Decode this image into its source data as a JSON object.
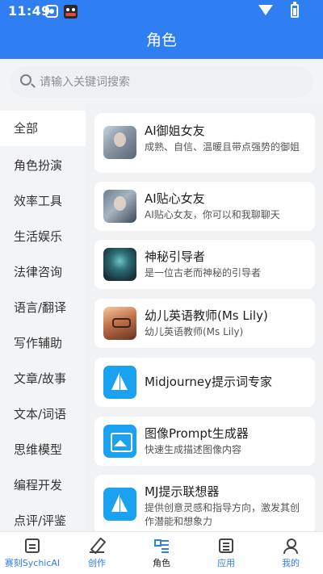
{
  "status_bar": {
    "time": "11:49"
  },
  "header": {
    "title": "角色"
  },
  "search": {
    "placeholder": "请输入关键词搜索"
  },
  "sidebar": {
    "active_index": 0,
    "items": [
      {
        "label": "全部"
      },
      {
        "label": "角色扮演"
      },
      {
        "label": "效率工具"
      },
      {
        "label": "生活娱乐"
      },
      {
        "label": "法律咨询"
      },
      {
        "label": "语言/翻译"
      },
      {
        "label": "写作辅助"
      },
      {
        "label": "文章/故事"
      },
      {
        "label": "文本/词语"
      },
      {
        "label": "思维模型"
      },
      {
        "label": "编程开发"
      },
      {
        "label": "点评/评鉴"
      }
    ]
  },
  "roles": [
    {
      "title": "AI御姐女友",
      "desc": "成熟、自信、温暖且带点强势的御姐",
      "icon": "portrait-avatar"
    },
    {
      "title": "AI贴心女友",
      "desc": "AI贴心女友，你可以和我聊聊天",
      "icon": "portrait-avatar"
    },
    {
      "title": "神秘引导者",
      "desc": "是一位古老而神秘的引导者",
      "icon": "mystic-avatar"
    },
    {
      "title": "幼儿英语教师(Ms Lily)",
      "desc": "幼儿英语教师(Ms Lily)",
      "icon": "teacher-avatar"
    },
    {
      "title": "Midjourney提示词专家",
      "desc": "",
      "icon": "sailboat-icon"
    },
    {
      "title": "图像Prompt生成器",
      "desc": "快速生成描述图像内容",
      "icon": "image-icon"
    },
    {
      "title": "MJ提示联想器",
      "desc": "提供创意灵感和指导方向，激发其创作潜能和想象力",
      "icon": "sailboat-icon"
    }
  ],
  "tabbar": {
    "active_index": 2,
    "tabs": [
      {
        "label": "赛刻SychicAI",
        "icon": "chat-icon"
      },
      {
        "label": "创作",
        "icon": "pen-icon"
      },
      {
        "label": "角色",
        "icon": "list-icon"
      },
      {
        "label": "应用",
        "icon": "doc-icon"
      },
      {
        "label": "我的",
        "icon": "user-icon"
      }
    ]
  },
  "colors": {
    "primary": "#2f7ef2",
    "sidebar_bg": "#f3f4f6",
    "card_bg": "#ffffff"
  }
}
